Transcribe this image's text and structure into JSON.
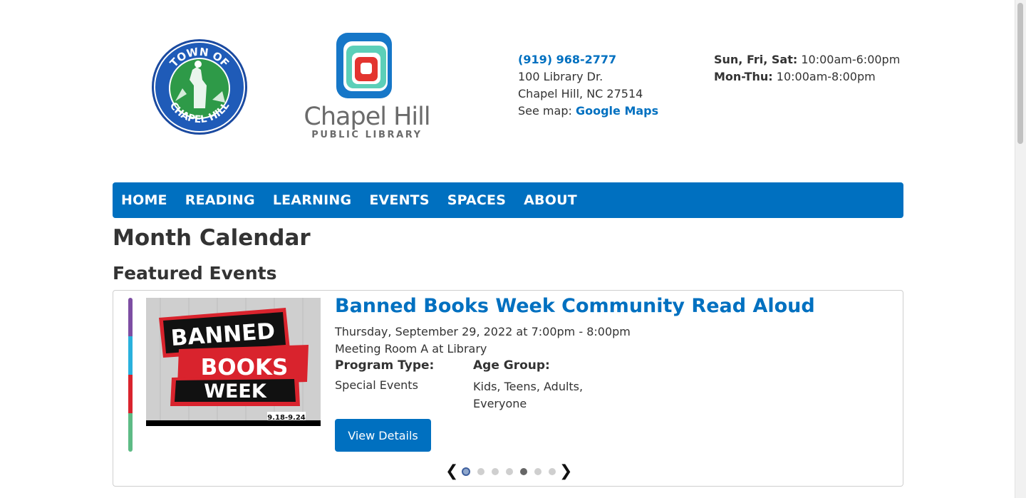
{
  "header": {
    "seal_icon": "town-of-chapel-hill-seal-icon",
    "seal_text_top": "TOWN OF",
    "seal_text_bottom": "CHAPEL HILL",
    "library_name": "Chapel Hill",
    "library_sub": "PUBLIC LIBRARY",
    "phone": "(919) 968-2777",
    "address_line1": "100 Library Dr.",
    "address_line2": "Chapel Hill, NC 27514",
    "map_prefix": "See map:",
    "map_link": "Google Maps",
    "hours": [
      {
        "days": "Sun, Fri, Sat:",
        "time": "10:00am-6:00pm"
      },
      {
        "days": "Mon-Thu:",
        "time": "10:00am-8:00pm"
      }
    ]
  },
  "nav": {
    "items": [
      "HOME",
      "READING",
      "LEARNING",
      "EVENTS",
      "SPACES",
      "ABOUT"
    ]
  },
  "page_title": "Month Calendar",
  "featured_heading": "Featured Events",
  "event": {
    "title": "Banned Books Week Community Read Aloud",
    "when": "Thursday, September 29, 2022 at 7:00pm - 8:00pm",
    "where": "Meeting Room A at Library",
    "program_type_label": "Program Type:",
    "program_type": "Special Events",
    "age_group_label": "Age Group:",
    "age_group": "Kids, Teens, Adults, Everyone",
    "button": "View Details",
    "image_line1": "BANNED",
    "image_line2": "BOOKS",
    "image_line3": "WEEK",
    "image_dates": "9.18-9.24",
    "stripe_colors": [
      "#7d4ea3",
      "#29b1dd",
      "#d9232d",
      "#5dbb85"
    ]
  },
  "pager": {
    "prev_icon": "chevron-left-icon",
    "next_icon": "chevron-right-icon",
    "dots": 7,
    "active": 0
  },
  "colors": {
    "brand": "#0070c0"
  }
}
